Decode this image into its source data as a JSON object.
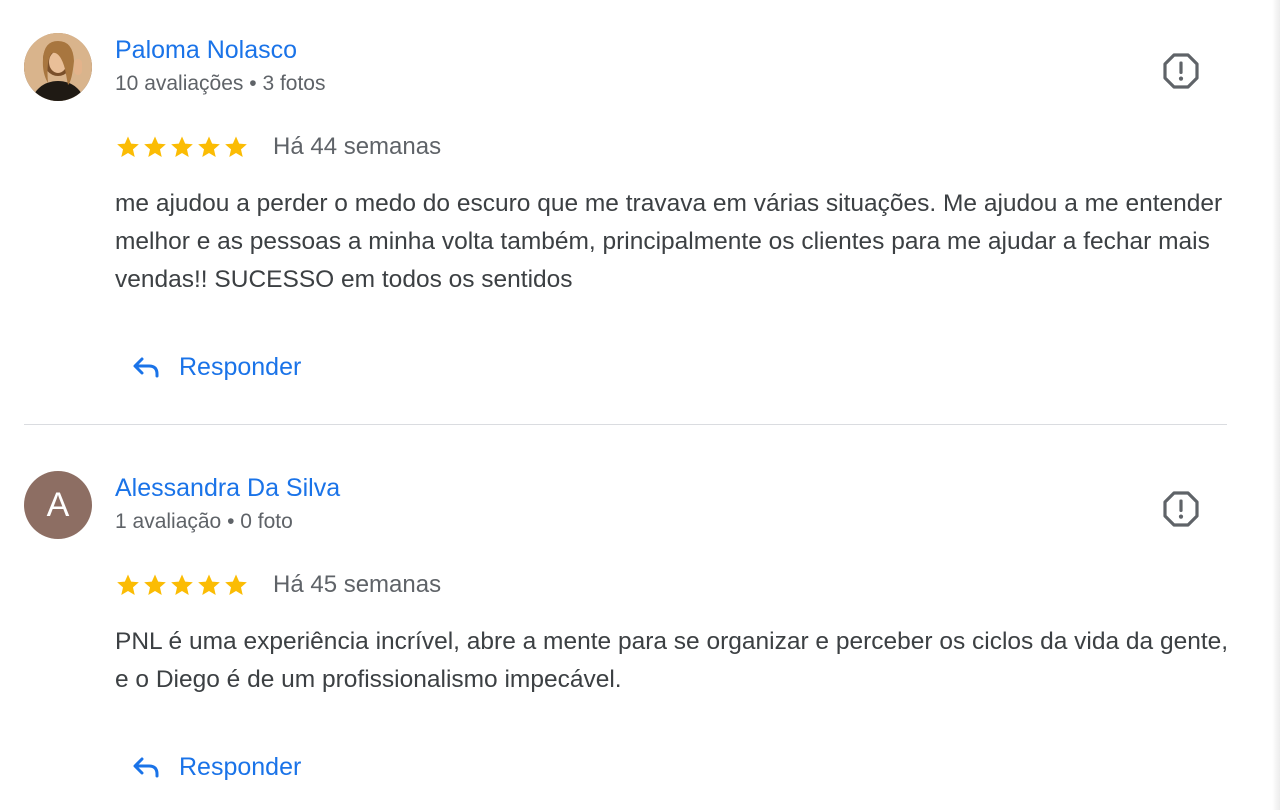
{
  "reviews": [
    {
      "author": "Paloma Nolasco",
      "meta": "10 avaliações • 3 fotos",
      "avatar_type": "photo",
      "avatar_letter": "",
      "rating": 5,
      "rating_max": 5,
      "date": "Há 44 semanas",
      "text": "me ajudou a perder o medo do escuro que me travava em várias situações. Me ajudou a me entender melhor e as pessoas a minha volta também, principalmente os clientes para me ajudar a fechar mais vendas!! SUCESSO em todos os sentidos",
      "reply_label": "Responder"
    },
    {
      "author": "Alessandra Da Silva",
      "meta": "1 avaliação • 0 foto",
      "avatar_type": "letter",
      "avatar_letter": "A",
      "rating": 5,
      "rating_max": 5,
      "date": "Há 45 semanas",
      "text": "PNL é uma experiência incrível, abre a mente para se organizar e perceber os ciclos da vida da gente, e o Diego é de um profissionalismo impecável.",
      "reply_label": "Responder"
    }
  ],
  "icons": {
    "star": "star-icon",
    "flag": "report-flag-icon",
    "reply": "reply-arrow-icon"
  },
  "colors": {
    "link_blue": "#1a73e8",
    "star_gold": "#fbbc04",
    "meta_gray": "#5f6368",
    "text_dark": "#3c4043",
    "divider": "#dadce0",
    "avatar_letter_bg": "#8d6e63"
  }
}
